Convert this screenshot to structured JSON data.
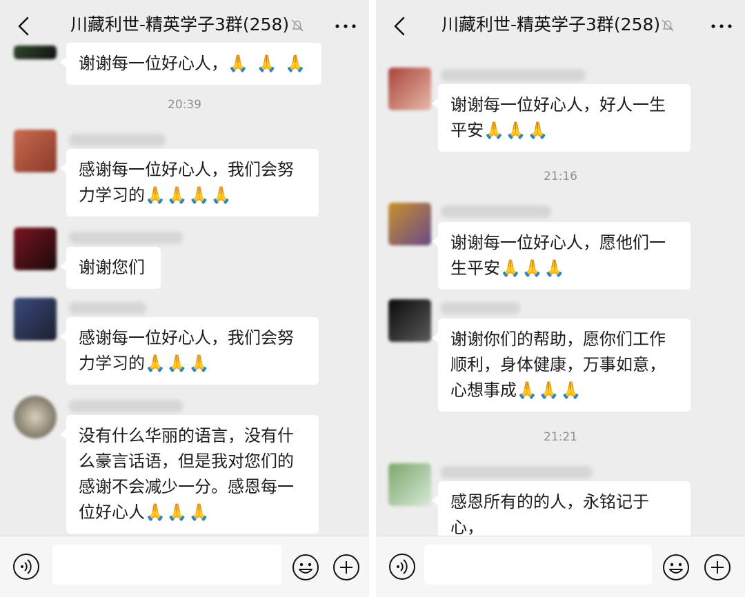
{
  "left": {
    "title": "川藏利世-精英学子3群(258)",
    "timestamps": [
      "20:39"
    ],
    "messages": [
      {
        "text": "谢谢每一位好心人，",
        "emoji": "🙏 🙏 🙏"
      },
      {
        "text": "感谢每一位好心人，我们会努力学习的",
        "emoji": "🙏🙏🙏🙏"
      },
      {
        "text": "谢谢您们",
        "emoji": ""
      },
      {
        "text": "感谢每一位好心人，我们会努力学习的",
        "emoji": "🙏🙏🙏"
      },
      {
        "text": "没有什么华丽的语言，没有什么豪言话语，但是我对您们的感谢不会减少一分。感恩每一位好心人",
        "emoji": "🙏🙏🙏"
      }
    ]
  },
  "right": {
    "title": "川藏利世-精英学子3群(258)",
    "timestamps": [
      "21:16",
      "21:21"
    ],
    "messages": [
      {
        "text": "谢谢每一位好心人，好人一生平安",
        "emoji": "🙏🙏🙏"
      },
      {
        "text": "谢谢每一位好心人，愿他们一生平安",
        "emoji": "🙏🙏🙏"
      },
      {
        "text": "谢谢你们的帮助，愿你们工作顺利，身体健康，万事如意，心想事成",
        "emoji": "🙏🙏🙏"
      },
      {
        "text": "感恩所有的的人，永铭记于心，",
        "emoji": ""
      }
    ]
  },
  "icons": {
    "back": "chevron-left-icon",
    "mute": "bell-off-icon",
    "more": "more-dots-icon",
    "voice": "voice-icon",
    "emoji": "emoji-smile-icon",
    "plus": "plus-circle-icon"
  },
  "colors": {
    "background": "#ededed",
    "bubble": "#ffffff",
    "timestamp": "#8f8f8f",
    "emoji": "#e7a83a"
  }
}
